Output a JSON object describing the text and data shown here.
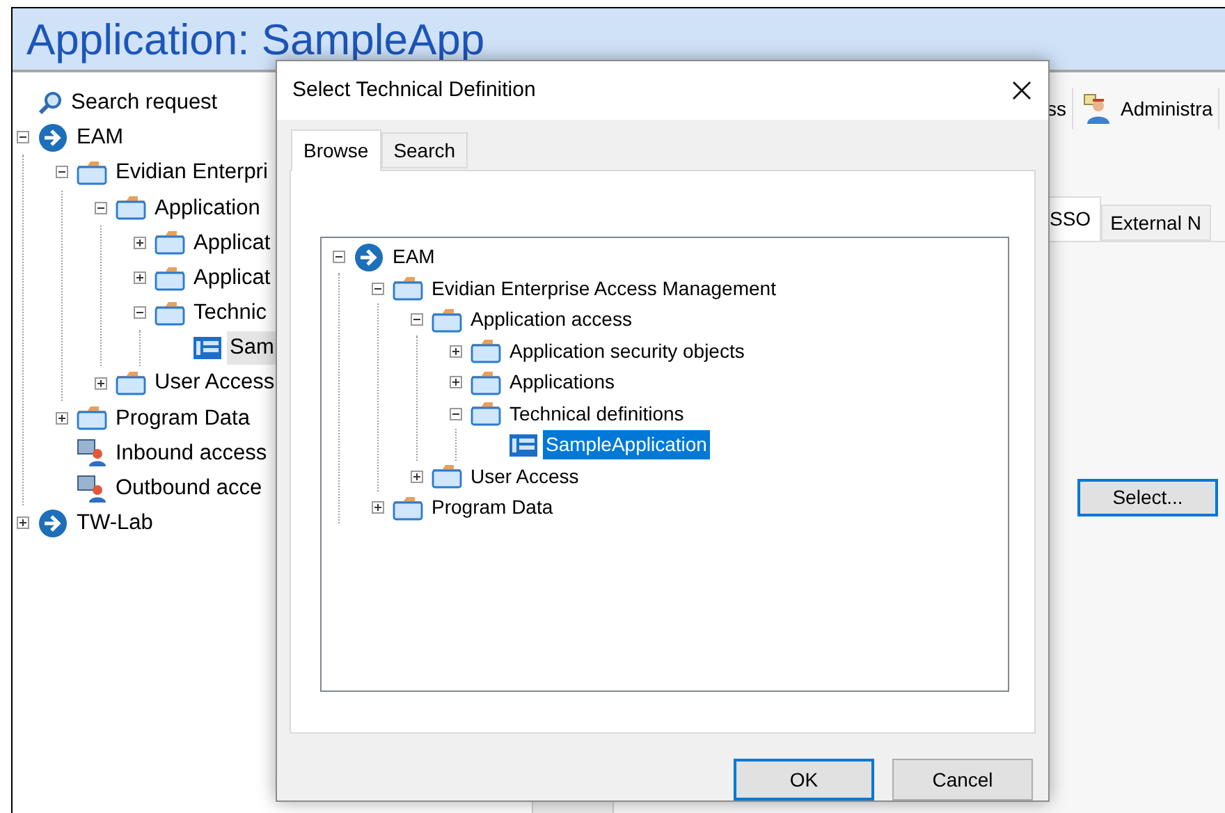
{
  "app_window": {
    "title": "Application: SampleApp",
    "tree": [
      {
        "label": "Search request",
        "kind": "search",
        "selected": false
      },
      {
        "label": "EAM",
        "kind": "root",
        "expanded": true,
        "selected": false,
        "children": [
          {
            "label": "Evidian Enterpri",
            "kind": "folder",
            "expanded": true,
            "selected": false,
            "children": [
              {
                "label": "Application",
                "kind": "folder",
                "expanded": true,
                "selected": false,
                "children": [
                  {
                    "label": "Applicat",
                    "kind": "folder",
                    "expanded": false,
                    "selected": false
                  },
                  {
                    "label": "Applicat",
                    "kind": "folder",
                    "expanded": false,
                    "selected": false
                  },
                  {
                    "label": "Technic",
                    "kind": "folder",
                    "expanded": true,
                    "selected": false,
                    "children": [
                      {
                        "label": "Sam",
                        "kind": "item",
                        "selected": true
                      }
                    ]
                  }
                ]
              },
              {
                "label": "User Access",
                "kind": "folder",
                "expanded": false,
                "selected": false
              }
            ]
          },
          {
            "label": "Program Data",
            "kind": "folder",
            "expanded": false,
            "selected": false
          },
          {
            "label": "Inbound access",
            "kind": "access",
            "selected": false
          },
          {
            "label": "Outbound acce",
            "kind": "access",
            "selected": false
          }
        ]
      },
      {
        "label": "TW-Lab",
        "kind": "root",
        "expanded": false,
        "selected": false
      }
    ],
    "toolbar": [
      {
        "label": "ss",
        "kind": "plain"
      },
      {
        "label": "Administra",
        "kind": "admin"
      }
    ],
    "tabs": [
      {
        "label": "SSO",
        "selected": true
      },
      {
        "label": "External N",
        "selected": false
      }
    ],
    "select_button": "Select..."
  },
  "dialog": {
    "title": "Select Technical Definition",
    "tabs": [
      {
        "label": "Browse",
        "selected": true
      },
      {
        "label": "Search",
        "selected": false
      }
    ],
    "tree": [
      {
        "label": "EAM",
        "kind": "root",
        "expanded": true,
        "selected": false,
        "children": [
          {
            "label": "Evidian Enterprise Access Management",
            "kind": "folder",
            "expanded": true,
            "selected": false,
            "children": [
              {
                "label": "Application access",
                "kind": "folder",
                "expanded": true,
                "selected": false,
                "children": [
                  {
                    "label": "Application security objects",
                    "kind": "folder",
                    "expanded": false,
                    "selected": false
                  },
                  {
                    "label": "Applications",
                    "kind": "folder",
                    "expanded": false,
                    "selected": false
                  },
                  {
                    "label": "Technical definitions",
                    "kind": "folder",
                    "expanded": true,
                    "selected": false,
                    "children": [
                      {
                        "label": "SampleApplication",
                        "kind": "item",
                        "selected": true
                      }
                    ]
                  }
                ]
              },
              {
                "label": "User Access",
                "kind": "folder",
                "expanded": false,
                "selected": false
              }
            ]
          },
          {
            "label": "Program Data",
            "kind": "folder",
            "expanded": false,
            "selected": false
          }
        ]
      }
    ],
    "buttons": [
      {
        "label": "OK",
        "default": true
      },
      {
        "label": "Cancel",
        "default": false
      }
    ]
  }
}
